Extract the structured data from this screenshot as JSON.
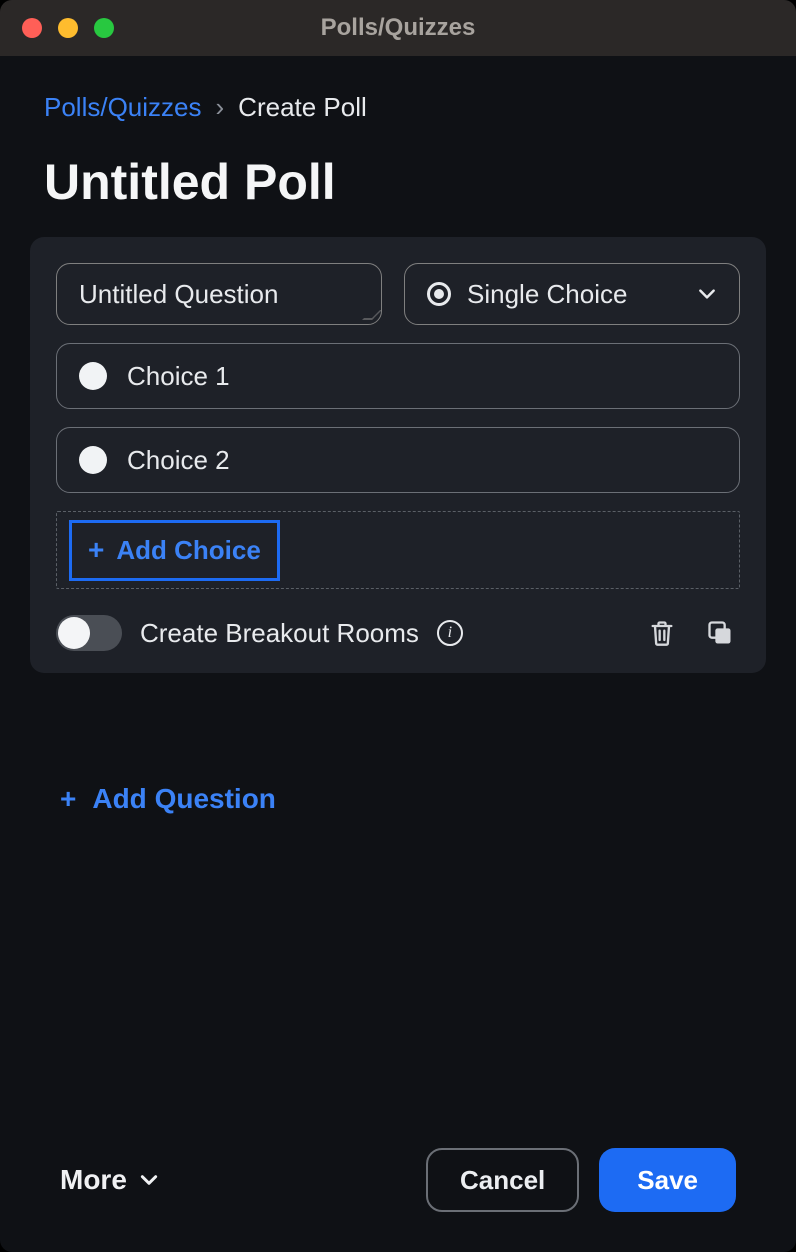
{
  "window_title": "Polls/Quizzes",
  "breadcrumb": {
    "root": "Polls/Quizzes",
    "separator": "›",
    "current": "Create Poll"
  },
  "page_title": "Untitled Poll",
  "question": {
    "title": "Untitled Question",
    "type_label": "Single Choice",
    "choices": [
      "Choice 1",
      "Choice 2"
    ],
    "add_choice_label": "Add Choice",
    "breakout_label": "Create Breakout Rooms",
    "breakout_on": false
  },
  "add_question_label": "Add Question",
  "footer": {
    "more_label": "More",
    "cancel_label": "Cancel",
    "save_label": "Save"
  }
}
